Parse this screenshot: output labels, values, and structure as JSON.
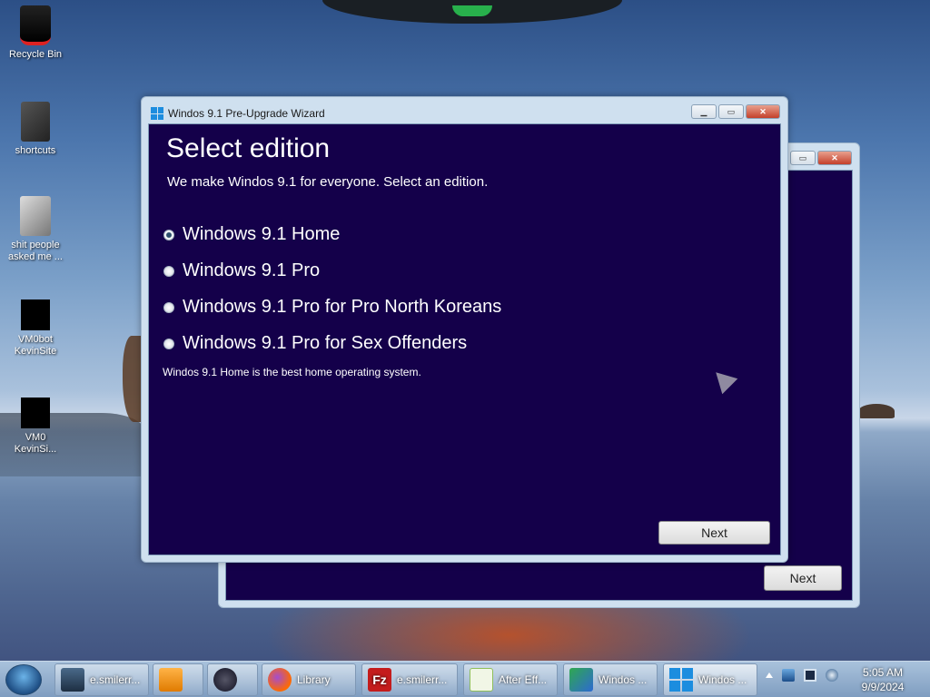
{
  "desktop": {
    "icons": [
      {
        "label": "Recycle Bin"
      },
      {
        "label": "shortcuts"
      },
      {
        "label": "shit people asked me ..."
      },
      {
        "label": "VM0bot KevinSite"
      },
      {
        "label": "VM0 KevinSi..."
      }
    ]
  },
  "wizard": {
    "title": "Windos 9.1 Pre-Upgrade Wizard",
    "heading": "Select edition",
    "subtitle": "We make Windos 9.1 for everyone. Select an edition.",
    "options": [
      {
        "label": "Windows 9.1 Home",
        "selected": true
      },
      {
        "label": "Windows 9.1 Pro",
        "selected": false
      },
      {
        "label": "Windows 9.1 Pro for Pro North Koreans",
        "selected": false
      },
      {
        "label": "Windows 9.1 Pro for Sex Offenders",
        "selected": false
      }
    ],
    "description": "Windos 9.1 Home is the best home operating system.",
    "next_label": "Next"
  },
  "back_window": {
    "next_label": "Next"
  },
  "taskbar": {
    "items": [
      {
        "label": "e.smilerr...",
        "icon": "monitor-icon"
      },
      {
        "label": "",
        "icon": "media-player-icon"
      },
      {
        "label": "",
        "icon": "globe-icon"
      },
      {
        "label": "Library",
        "icon": "firefox-icon"
      },
      {
        "label": "e.smilerr...",
        "icon": "filezilla-icon"
      },
      {
        "label": "After Eff...",
        "icon": "after-effects-icon"
      },
      {
        "label": "Windos ...",
        "icon": "installer-icon"
      },
      {
        "label": "Windos ...",
        "icon": "windows-logo-icon"
      }
    ],
    "clock_time": "5:05 AM",
    "clock_date": "9/9/2024"
  },
  "colors": {
    "wizard_bg": "#14004a",
    "title_bar": "#cfe0ef",
    "close_button": "#c4402a"
  }
}
